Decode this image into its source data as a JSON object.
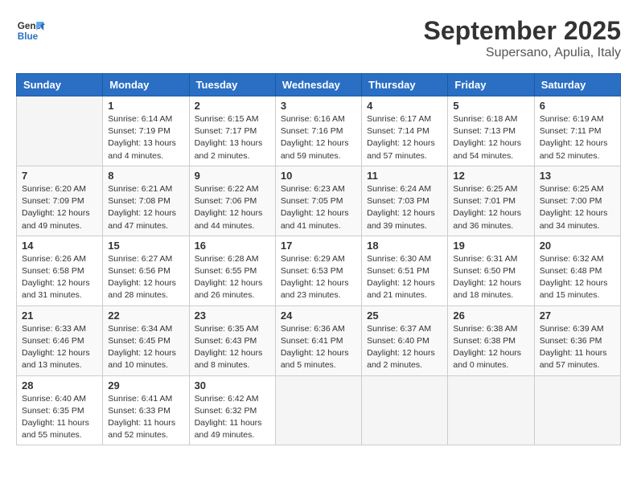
{
  "header": {
    "logo_line1": "General",
    "logo_line2": "Blue",
    "month": "September 2025",
    "location": "Supersano, Apulia, Italy"
  },
  "weekdays": [
    "Sunday",
    "Monday",
    "Tuesday",
    "Wednesday",
    "Thursday",
    "Friday",
    "Saturday"
  ],
  "weeks": [
    [
      {
        "day": "",
        "sunrise": "",
        "sunset": "",
        "daylight": ""
      },
      {
        "day": "1",
        "sunrise": "Sunrise: 6:14 AM",
        "sunset": "Sunset: 7:19 PM",
        "daylight": "Daylight: 13 hours and 4 minutes."
      },
      {
        "day": "2",
        "sunrise": "Sunrise: 6:15 AM",
        "sunset": "Sunset: 7:17 PM",
        "daylight": "Daylight: 13 hours and 2 minutes."
      },
      {
        "day": "3",
        "sunrise": "Sunrise: 6:16 AM",
        "sunset": "Sunset: 7:16 PM",
        "daylight": "Daylight: 12 hours and 59 minutes."
      },
      {
        "day": "4",
        "sunrise": "Sunrise: 6:17 AM",
        "sunset": "Sunset: 7:14 PM",
        "daylight": "Daylight: 12 hours and 57 minutes."
      },
      {
        "day": "5",
        "sunrise": "Sunrise: 6:18 AM",
        "sunset": "Sunset: 7:13 PM",
        "daylight": "Daylight: 12 hours and 54 minutes."
      },
      {
        "day": "6",
        "sunrise": "Sunrise: 6:19 AM",
        "sunset": "Sunset: 7:11 PM",
        "daylight": "Daylight: 12 hours and 52 minutes."
      }
    ],
    [
      {
        "day": "7",
        "sunrise": "Sunrise: 6:20 AM",
        "sunset": "Sunset: 7:09 PM",
        "daylight": "Daylight: 12 hours and 49 minutes."
      },
      {
        "day": "8",
        "sunrise": "Sunrise: 6:21 AM",
        "sunset": "Sunset: 7:08 PM",
        "daylight": "Daylight: 12 hours and 47 minutes."
      },
      {
        "day": "9",
        "sunrise": "Sunrise: 6:22 AM",
        "sunset": "Sunset: 7:06 PM",
        "daylight": "Daylight: 12 hours and 44 minutes."
      },
      {
        "day": "10",
        "sunrise": "Sunrise: 6:23 AM",
        "sunset": "Sunset: 7:05 PM",
        "daylight": "Daylight: 12 hours and 41 minutes."
      },
      {
        "day": "11",
        "sunrise": "Sunrise: 6:24 AM",
        "sunset": "Sunset: 7:03 PM",
        "daylight": "Daylight: 12 hours and 39 minutes."
      },
      {
        "day": "12",
        "sunrise": "Sunrise: 6:25 AM",
        "sunset": "Sunset: 7:01 PM",
        "daylight": "Daylight: 12 hours and 36 minutes."
      },
      {
        "day": "13",
        "sunrise": "Sunrise: 6:25 AM",
        "sunset": "Sunset: 7:00 PM",
        "daylight": "Daylight: 12 hours and 34 minutes."
      }
    ],
    [
      {
        "day": "14",
        "sunrise": "Sunrise: 6:26 AM",
        "sunset": "Sunset: 6:58 PM",
        "daylight": "Daylight: 12 hours and 31 minutes."
      },
      {
        "day": "15",
        "sunrise": "Sunrise: 6:27 AM",
        "sunset": "Sunset: 6:56 PM",
        "daylight": "Daylight: 12 hours and 28 minutes."
      },
      {
        "day": "16",
        "sunrise": "Sunrise: 6:28 AM",
        "sunset": "Sunset: 6:55 PM",
        "daylight": "Daylight: 12 hours and 26 minutes."
      },
      {
        "day": "17",
        "sunrise": "Sunrise: 6:29 AM",
        "sunset": "Sunset: 6:53 PM",
        "daylight": "Daylight: 12 hours and 23 minutes."
      },
      {
        "day": "18",
        "sunrise": "Sunrise: 6:30 AM",
        "sunset": "Sunset: 6:51 PM",
        "daylight": "Daylight: 12 hours and 21 minutes."
      },
      {
        "day": "19",
        "sunrise": "Sunrise: 6:31 AM",
        "sunset": "Sunset: 6:50 PM",
        "daylight": "Daylight: 12 hours and 18 minutes."
      },
      {
        "day": "20",
        "sunrise": "Sunrise: 6:32 AM",
        "sunset": "Sunset: 6:48 PM",
        "daylight": "Daylight: 12 hours and 15 minutes."
      }
    ],
    [
      {
        "day": "21",
        "sunrise": "Sunrise: 6:33 AM",
        "sunset": "Sunset: 6:46 PM",
        "daylight": "Daylight: 12 hours and 13 minutes."
      },
      {
        "day": "22",
        "sunrise": "Sunrise: 6:34 AM",
        "sunset": "Sunset: 6:45 PM",
        "daylight": "Daylight: 12 hours and 10 minutes."
      },
      {
        "day": "23",
        "sunrise": "Sunrise: 6:35 AM",
        "sunset": "Sunset: 6:43 PM",
        "daylight": "Daylight: 12 hours and 8 minutes."
      },
      {
        "day": "24",
        "sunrise": "Sunrise: 6:36 AM",
        "sunset": "Sunset: 6:41 PM",
        "daylight": "Daylight: 12 hours and 5 minutes."
      },
      {
        "day": "25",
        "sunrise": "Sunrise: 6:37 AM",
        "sunset": "Sunset: 6:40 PM",
        "daylight": "Daylight: 12 hours and 2 minutes."
      },
      {
        "day": "26",
        "sunrise": "Sunrise: 6:38 AM",
        "sunset": "Sunset: 6:38 PM",
        "daylight": "Daylight: 12 hours and 0 minutes."
      },
      {
        "day": "27",
        "sunrise": "Sunrise: 6:39 AM",
        "sunset": "Sunset: 6:36 PM",
        "daylight": "Daylight: 11 hours and 57 minutes."
      }
    ],
    [
      {
        "day": "28",
        "sunrise": "Sunrise: 6:40 AM",
        "sunset": "Sunset: 6:35 PM",
        "daylight": "Daylight: 11 hours and 55 minutes."
      },
      {
        "day": "29",
        "sunrise": "Sunrise: 6:41 AM",
        "sunset": "Sunset: 6:33 PM",
        "daylight": "Daylight: 11 hours and 52 minutes."
      },
      {
        "day": "30",
        "sunrise": "Sunrise: 6:42 AM",
        "sunset": "Sunset: 6:32 PM",
        "daylight": "Daylight: 11 hours and 49 minutes."
      },
      {
        "day": "",
        "sunrise": "",
        "sunset": "",
        "daylight": ""
      },
      {
        "day": "",
        "sunrise": "",
        "sunset": "",
        "daylight": ""
      },
      {
        "day": "",
        "sunrise": "",
        "sunset": "",
        "daylight": ""
      },
      {
        "day": "",
        "sunrise": "",
        "sunset": "",
        "daylight": ""
      }
    ]
  ]
}
